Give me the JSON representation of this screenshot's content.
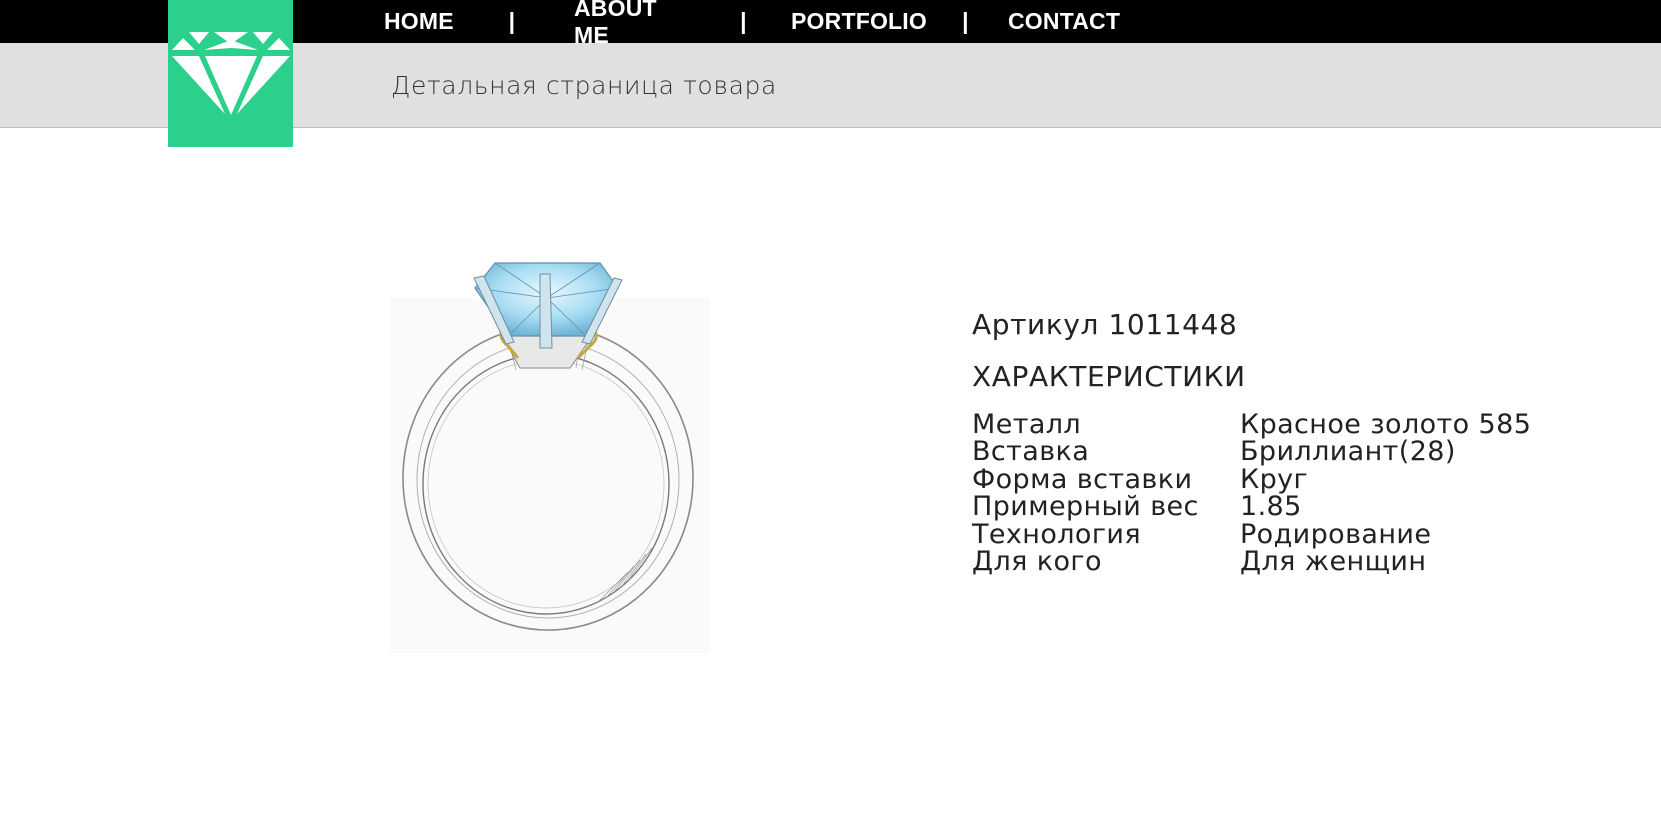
{
  "nav": {
    "items": [
      {
        "label": "HOME"
      },
      {
        "label": "ABOUT ME"
      },
      {
        "label": "PORTFOLIO"
      },
      {
        "label": "CONTACT"
      }
    ],
    "separator": "|"
  },
  "header": {
    "subtitle": "Детальная страница товара",
    "logo_icon": "diamond-icon",
    "logo_color": "#2ad08c"
  },
  "product": {
    "article": "Артикул 1011448",
    "specs_title": "ХАРАКТЕРИСТИКИ",
    "specs": [
      {
        "key": "Металл",
        "value": "Красное золото 585"
      },
      {
        "key": "Вставка",
        "value": "Бриллиант(28)"
      },
      {
        "key": "Форма вставки",
        "value": "Круг"
      },
      {
        "key": "Примерный вес",
        "value": "1.85"
      },
      {
        "key": "Технология",
        "value": "Родирование"
      },
      {
        "key": "Для кого",
        "value": "Для женщин"
      }
    ]
  },
  "colors": {
    "topbar": "#000000",
    "subbar": "#e0e0e0",
    "accent": "#2ad08c"
  }
}
